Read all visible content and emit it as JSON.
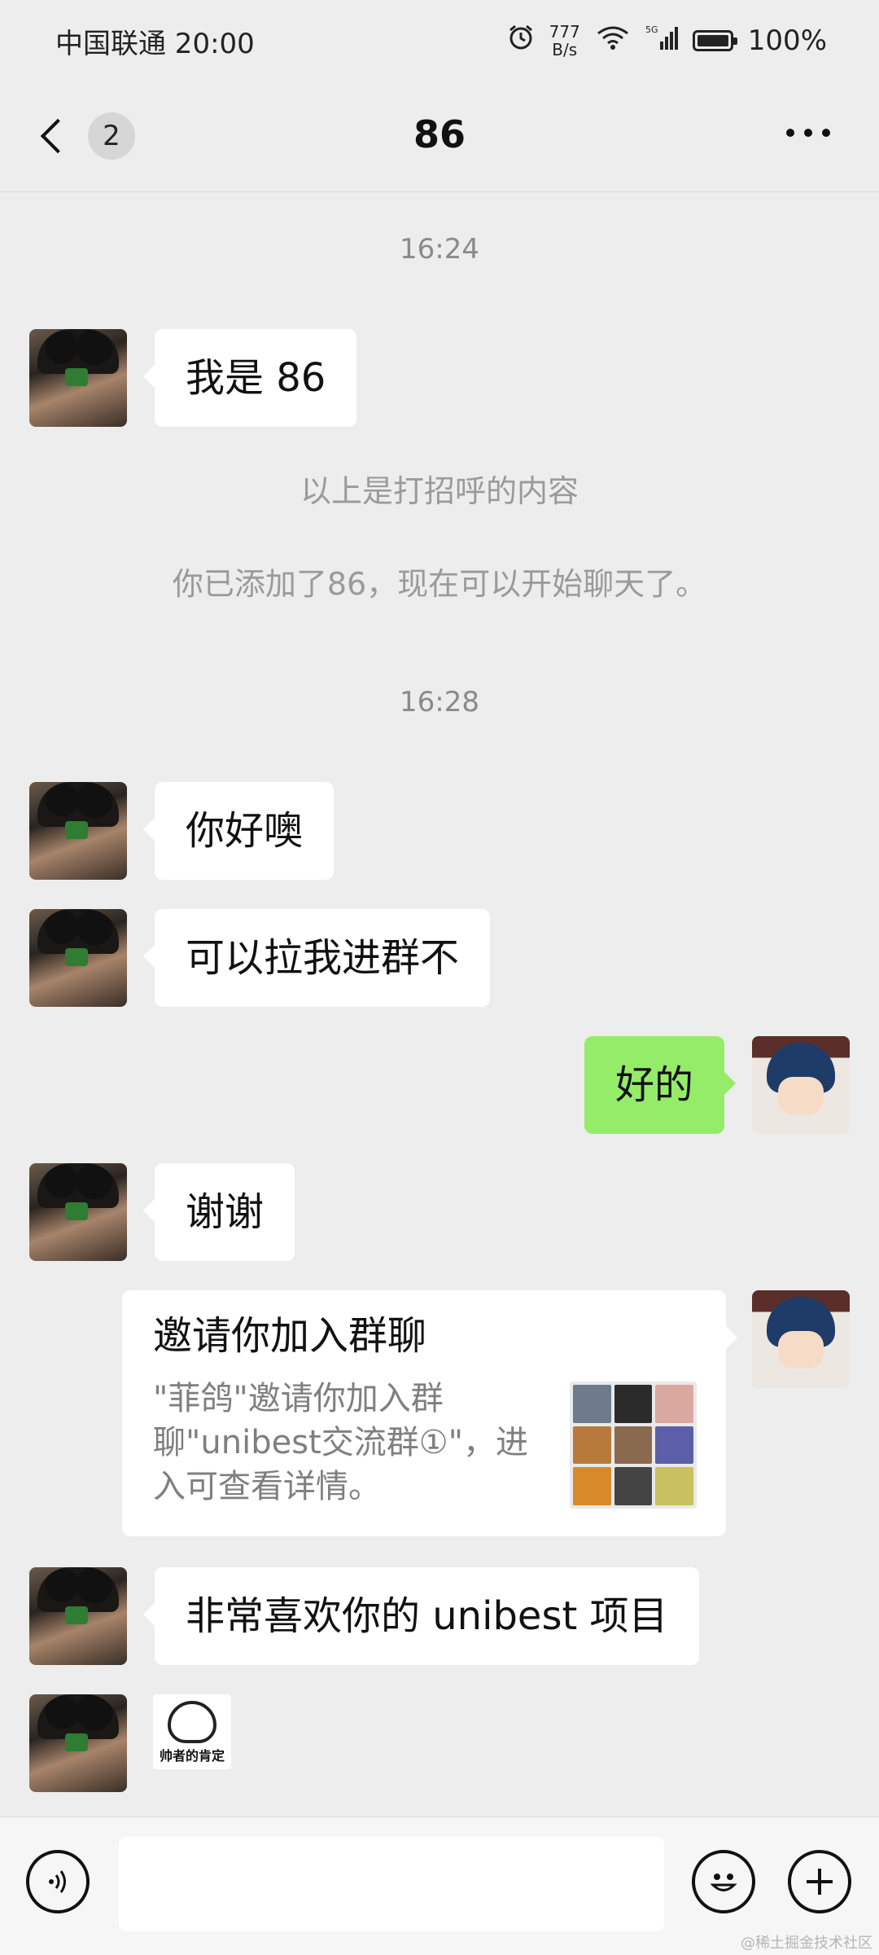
{
  "status_bar": {
    "carrier_time": "中国联通 20:00",
    "speed_value": "777",
    "speed_unit": "B/s",
    "network": "5G",
    "battery": "100%"
  },
  "nav": {
    "unread_count": "2",
    "title": "86"
  },
  "messages": {
    "time1": "16:24",
    "msg1": "我是 86",
    "sys1": "以上是打招呼的内容",
    "sys2": "你已添加了86，现在可以开始聊天了。",
    "time2": "16:28",
    "msg2": "你好噢",
    "msg3": "可以拉我进群不",
    "msg4": "好的",
    "msg5": "谢谢",
    "invite_title": "邀请你加入群聊",
    "invite_desc": "\"菲鸽\"邀请你加入群聊\"unibest交流群①\"，进入可查看详情。",
    "msg6": "非常喜欢你的 unibest 项目",
    "sticker_caption": "帅者的肯定"
  },
  "watermark": "@稀土掘金技术社区",
  "colors": {
    "background": "#ededed",
    "bubble_received": "#ffffff",
    "bubble_sent": "#95ec69",
    "system_text": "#9a9a9a"
  },
  "icons": [
    "back-chevron-icon",
    "more-icon",
    "voice-icon",
    "emoji-icon",
    "plus-icon",
    "alarm-icon",
    "wifi-icon",
    "signal-icon",
    "battery-icon"
  ]
}
